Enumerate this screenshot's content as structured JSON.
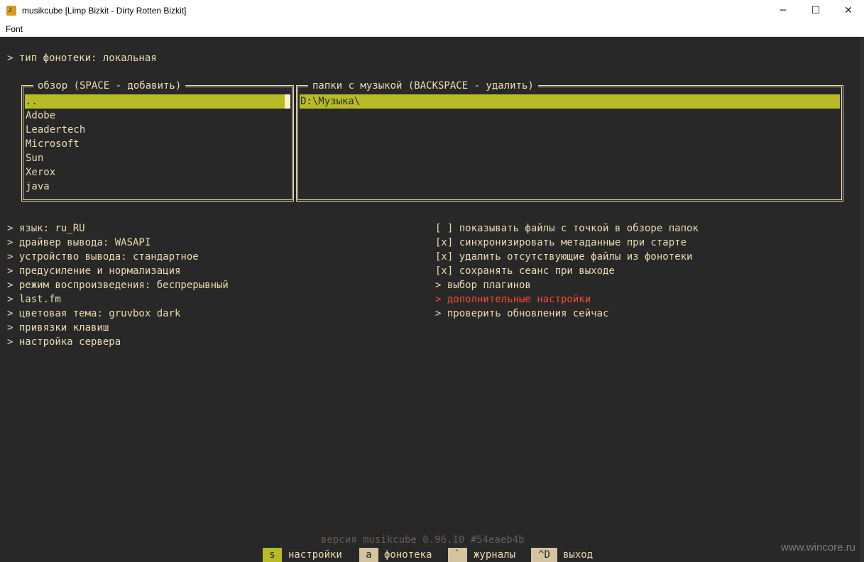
{
  "window": {
    "title": "musikcube [Limp Bizkit - Dirty Rotten Bizkit]",
    "min_label": "─",
    "max_label": "☐",
    "close_label": "✕"
  },
  "menu": {
    "font": "Font"
  },
  "library_type": "> тип фонотеки: локальная",
  "browse": {
    "title": "обзор (SPACE - добавить)",
    "items": [
      "..",
      "Adobe",
      "Leadertech",
      "Microsoft",
      "Sun",
      "Xerox",
      "java"
    ],
    "selected_index": 0
  },
  "folders": {
    "title": "папки с музыкой (BACKSPACE - удалить)",
    "items": [
      "D:\\Музыка\\"
    ],
    "selected_index": 0
  },
  "left_settings": [
    "> язык: ru_RU",
    "> драйвер вывода: WASAPI",
    "> устройство вывода: стандартное",
    "> предусиление и нормализация",
    "> режим воспроизведения: беспрерывный",
    "> last.fm",
    "> цветовая тема: gruvbox dark",
    "> привязки клавиш",
    "> настройка сервера"
  ],
  "right_settings": [
    "[ ] показывать файлы с точкой в обзоре папок",
    "[x] синхронизировать метаданные при старте",
    "[x] удалить отсутствующие файлы из фонотеки",
    "[x] сохранять сеанс при выходе",
    "> выбор плагинов",
    "> дополнительные настройки",
    "> проверить обновления сейчас"
  ],
  "highlight_color": "#fb4934",
  "accent_color": "#b8bb26",
  "version": "версия musikcube 0.96.10 #54eaeb4b",
  "footer": [
    {
      "key": "s",
      "label": "настройки",
      "active": true
    },
    {
      "key": "a",
      "label": "фонотека",
      "active": false
    },
    {
      "key": "`",
      "label": "журналы",
      "active": false
    },
    {
      "key": "^D",
      "label": "выход",
      "active": false
    }
  ],
  "watermark": "www.wincore.ru"
}
